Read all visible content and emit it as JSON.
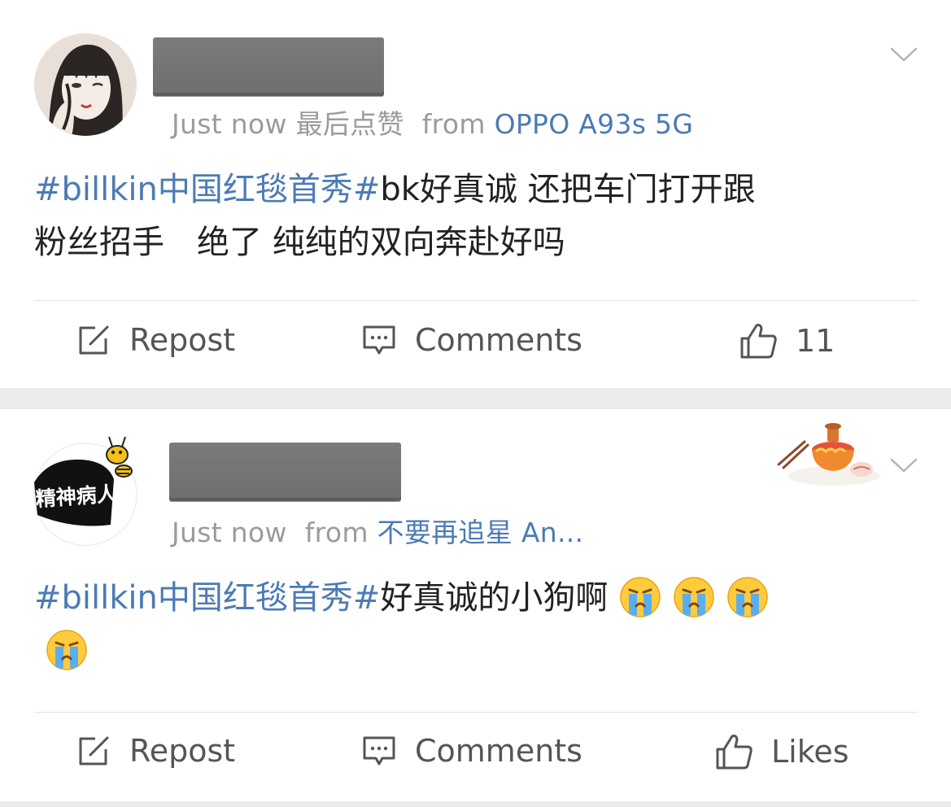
{
  "feed": {
    "posts": [
      {
        "author_name": "",
        "timestamp": "Just now",
        "last_liked": "最后点赞",
        "from_label": "from",
        "source": "OPPO A93s 5G",
        "hashtag": "#billkin中国红毯首秀#",
        "text_line1": "bk好真诚 还把车门打开跟",
        "text_line2": "粉丝招手　绝了 纯纯的双向奔赴好吗",
        "actions": {
          "repost": "Repost",
          "comments": "Comments",
          "likes": "11"
        }
      },
      {
        "author_name": "",
        "avatar_text": "精神病人",
        "timestamp": "Just now",
        "from_label": "from",
        "source": "不要再追星 An...",
        "hashtag": "#billkin中国红毯首秀#",
        "text": "好真诚的小狗啊",
        "emoji_count": 4,
        "actions": {
          "repost": "Repost",
          "comments": "Comments",
          "likes": "Likes"
        }
      }
    ]
  },
  "colors": {
    "link": "#4c7bb5",
    "meta_text": "#9b9b9b",
    "body_text": "#222222",
    "separator": "#ebebeb"
  },
  "icons": [
    "chevron-down-icon",
    "repost-icon",
    "comment-icon",
    "thumbs-up-icon",
    "crying-emoji-icon",
    "hotpot-sticker-icon"
  ]
}
